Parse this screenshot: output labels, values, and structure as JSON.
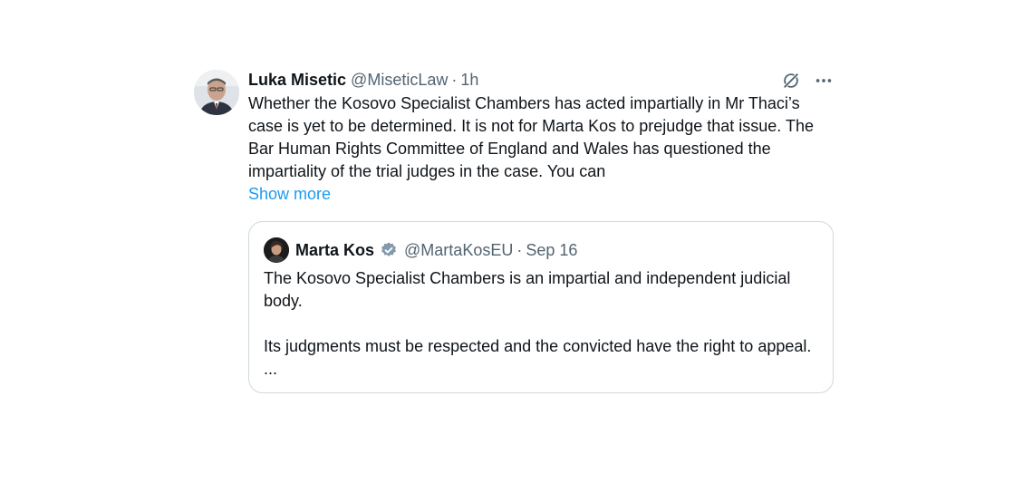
{
  "tweet": {
    "author_name": "Luka Misetic",
    "author_handle": "@MiseticLaw",
    "separator": "·",
    "timestamp": "1h",
    "text": "Whether the Kosovo Specialist Chambers has acted impartially in Mr Thaci’s case is yet to be determined. It is not for Marta Kos to prejudge that issue. The Bar Human Rights Committee of England and Wales has questioned the impartiality of the trial judges in the case.  You can",
    "show_more": "Show more",
    "icons": {
      "grok": "grok-icon",
      "more": "more-options-icon"
    }
  },
  "quote": {
    "author_name": "Marta Kos",
    "author_handle": "@MartaKosEU",
    "separator": "·",
    "timestamp": "Sep 16",
    "paragraph_1": "The Kosovo Specialist Chambers is an impartial and independent judicial body.",
    "paragraph_2": "Its judgments must be respected and the convicted have the right to appeal. ...",
    "verified_icon": "verified-badge-icon"
  },
  "colors": {
    "text": "#0f1419",
    "secondary": "#536471",
    "link": "#1d9bf0",
    "border": "#cfd9de",
    "verified_badge": "#829aab"
  }
}
